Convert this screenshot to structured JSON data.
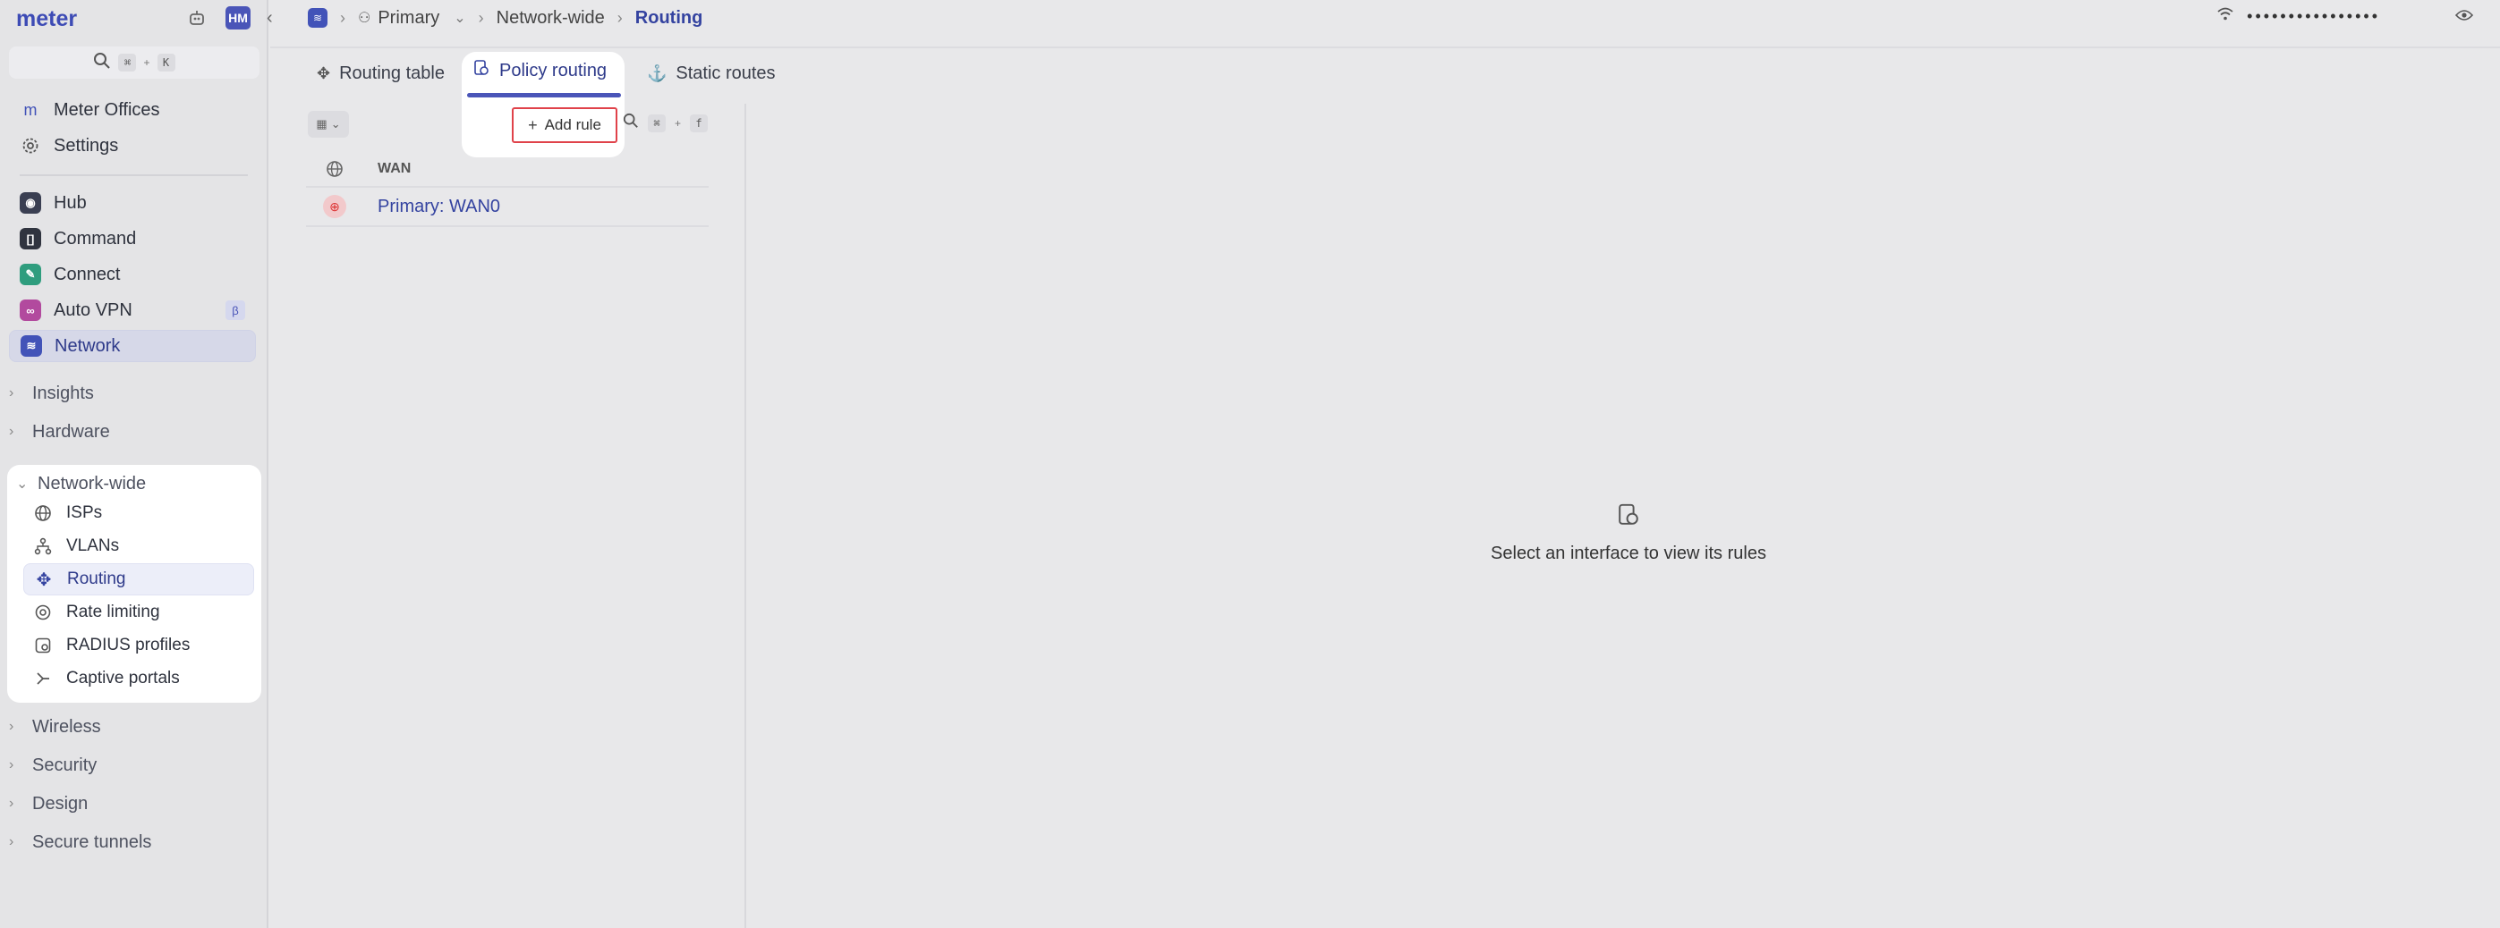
{
  "sidebar": {
    "logo": "meter",
    "avatar_initials": "HM",
    "search": {
      "key1": "⌘",
      "plus": "+",
      "key2": "K"
    },
    "org_items": [
      {
        "label": "Meter Offices",
        "icon": "m"
      },
      {
        "label": "Settings",
        "icon": "gear-icon"
      }
    ],
    "products": [
      {
        "label": "Hub",
        "icon": "hub-icon"
      },
      {
        "label": "Command",
        "icon": "command-icon"
      },
      {
        "label": "Connect",
        "icon": "connect-icon"
      },
      {
        "label": "Auto VPN",
        "icon": "autovpn-icon",
        "badge": "β"
      },
      {
        "label": "Network",
        "icon": "network-icon",
        "active": true
      }
    ],
    "sections": {
      "insights": "Insights",
      "hardware": "Hardware",
      "network_wide": "Network-wide",
      "wireless": "Wireless",
      "security": "Security",
      "design": "Design",
      "secure_tunnels": "Secure tunnels"
    },
    "network_wide_items": [
      {
        "label": "ISPs",
        "icon": "globe-icon"
      },
      {
        "label": "VLANs",
        "icon": "vlan-icon"
      },
      {
        "label": "Routing",
        "icon": "routing-icon",
        "active": true
      },
      {
        "label": "Rate limiting",
        "icon": "rate-limit-icon"
      },
      {
        "label": "RADIUS profiles",
        "icon": "radius-icon"
      },
      {
        "label": "Captive portals",
        "icon": "captive-portal-icon"
      }
    ]
  },
  "breadcrumb": {
    "network": "Primary",
    "section": "Network-wide",
    "current": "Routing"
  },
  "topbar": {
    "password_mask": "••••••••••••••••"
  },
  "tabs": {
    "routing_table": "Routing table",
    "policy_routing": "Policy routing",
    "static_routes": "Static routes",
    "selected": "Policy routing"
  },
  "toolbar": {
    "add_rule": "Add rule",
    "search_key1": "⌘",
    "search_plus": "+",
    "search_key2": "f"
  },
  "table": {
    "column": "WAN",
    "rows": [
      {
        "label": "Primary: WAN0",
        "status": "offline"
      }
    ]
  },
  "empty_state": {
    "message": "Select an interface to view its rules"
  },
  "colors": {
    "accent": "#4a55b8",
    "link": "#3443a0",
    "highlight_border": "#e0424a",
    "status_offline": "#d33333"
  }
}
